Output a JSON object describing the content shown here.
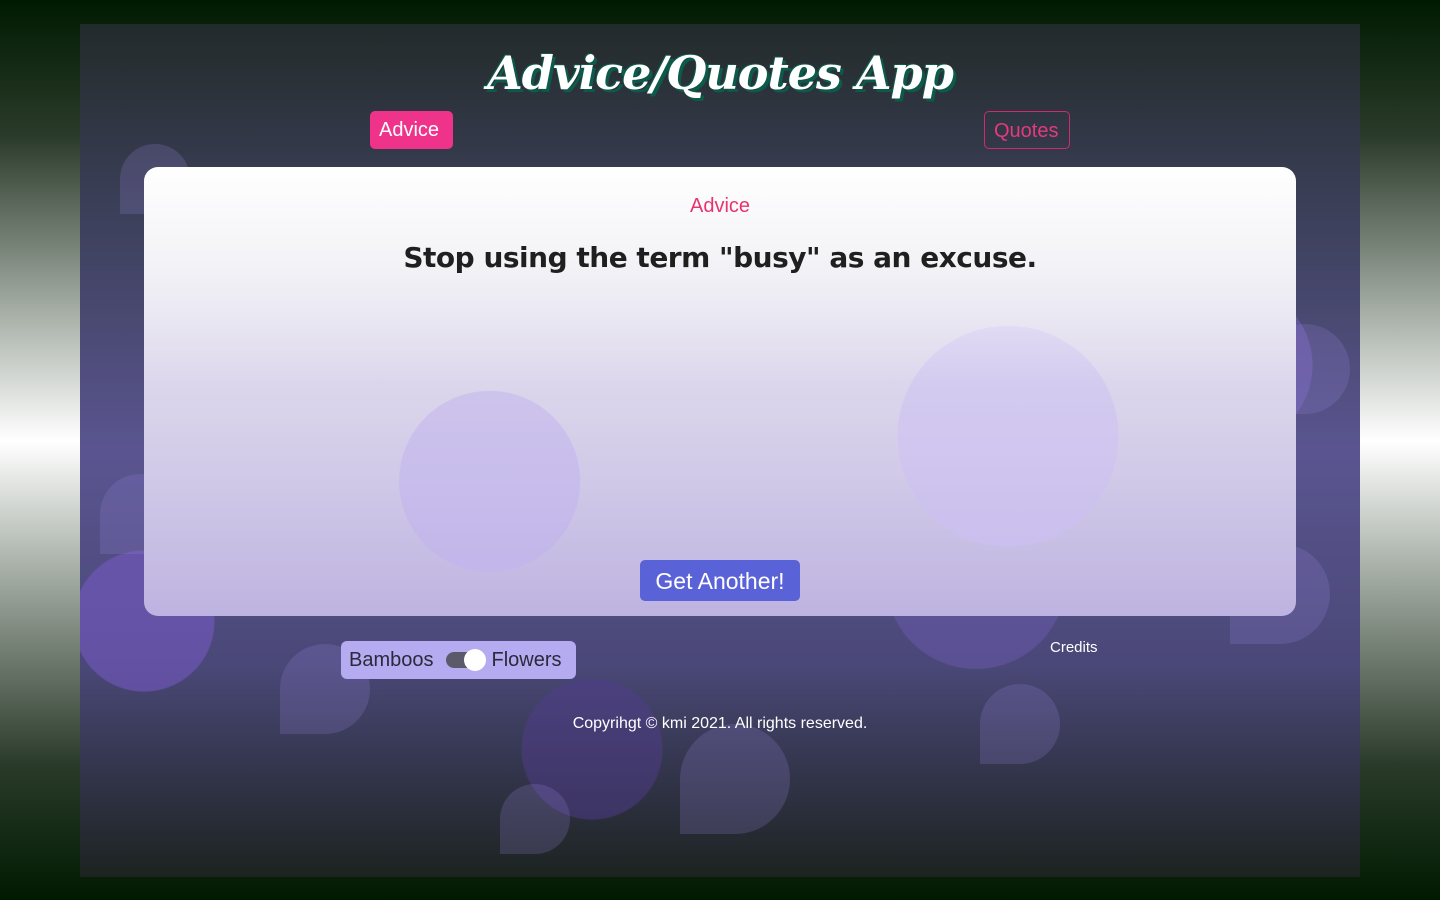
{
  "app": {
    "title": "Advice/Quotes App"
  },
  "tabs": [
    {
      "label": "Advice",
      "active": true
    },
    {
      "label": "Quotes",
      "active": false
    }
  ],
  "card": {
    "label": "Advice",
    "text": "Stop using the term \"busy\" as an excuse.",
    "button_label": "Get Another!"
  },
  "theme_toggle": {
    "left_label": "Bamboos",
    "right_label": "Flowers",
    "selected": "Flowers"
  },
  "footer": {
    "credits_label": "Credits",
    "copyright": "Copyrihgt © kmi 2021. All rights reserved."
  },
  "colors": {
    "accent_pink": "#f0338a",
    "button_blue": "#5a62d8",
    "toggle_bg": "#b4abf0"
  }
}
